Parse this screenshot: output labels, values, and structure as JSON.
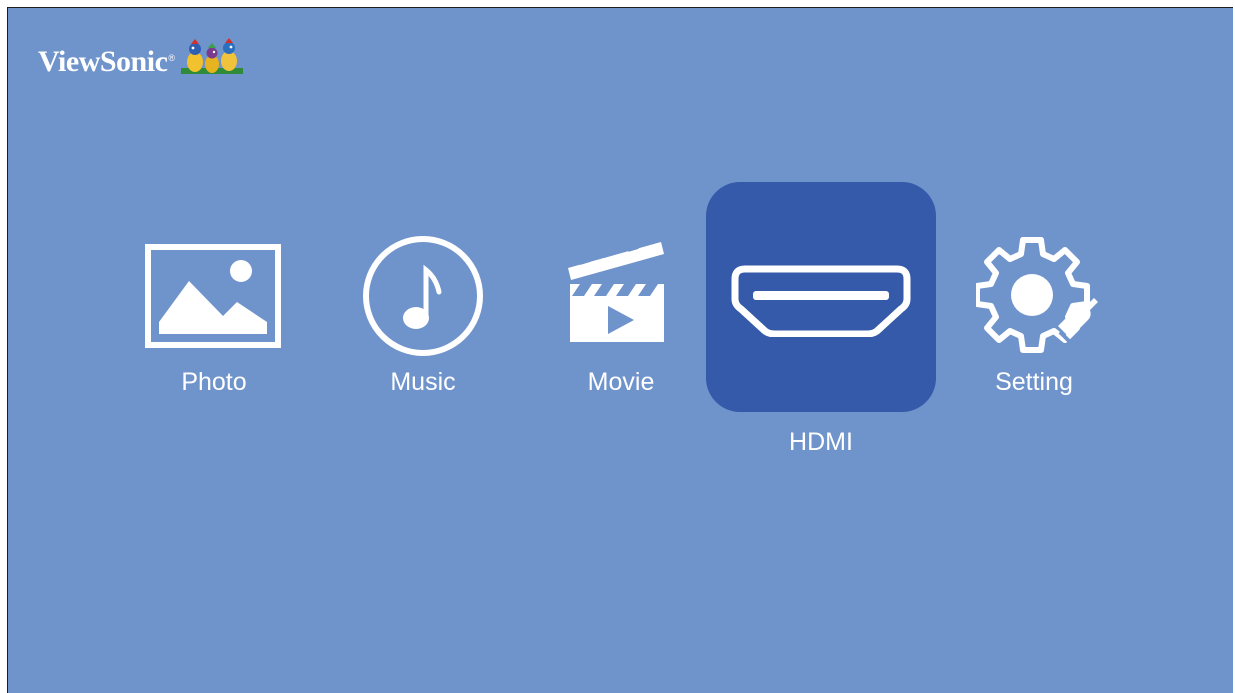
{
  "brand": {
    "name": "ViewSonic",
    "registered_mark": "®"
  },
  "colors": {
    "background": "#6f93cb",
    "selected_tile": "#355aa9",
    "foreground": "#ffffff"
  },
  "menu": {
    "selected": "HDMI",
    "items": [
      {
        "label": "Photo",
        "icon": "photo-icon"
      },
      {
        "label": "Music",
        "icon": "music-note-icon"
      },
      {
        "label": "Movie",
        "icon": "clapperboard-icon"
      },
      {
        "label": "HDMI",
        "icon": "hdmi-port-icon"
      },
      {
        "label": "Setting",
        "icon": "gear-wrench-icon"
      }
    ]
  }
}
